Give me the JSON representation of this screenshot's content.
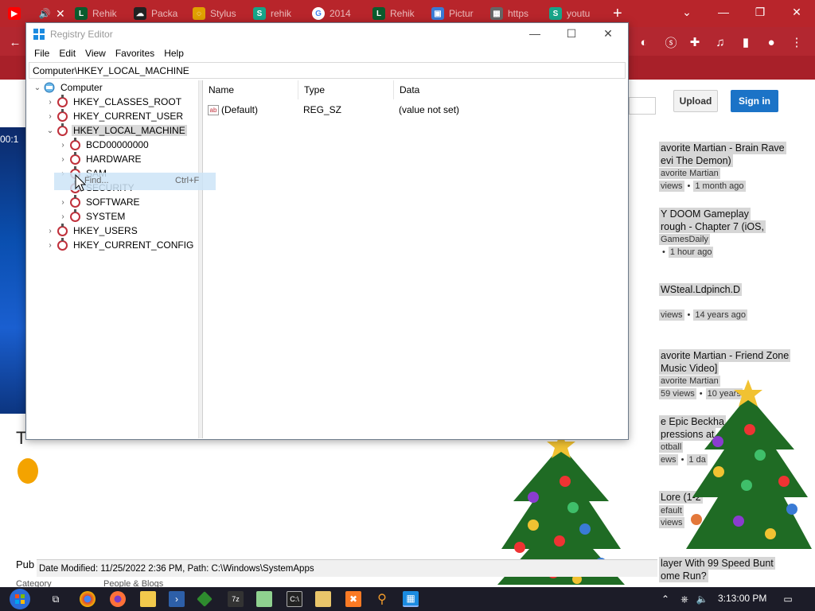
{
  "browser": {
    "tabs": [
      {
        "title": "",
        "color": "#ff0000",
        "glyph": "▶"
      },
      {
        "title": "",
        "color": "#b8252b",
        "glyph": "🔊"
      },
      {
        "title": "Rehik",
        "color": "#0b5c2e",
        "glyph": "L"
      },
      {
        "title": "Packa",
        "color": "#222222",
        "glyph": "☁"
      },
      {
        "title": "Stylus",
        "color": "#e0a000",
        "glyph": "◌"
      },
      {
        "title": "rehik",
        "color": "#17a589",
        "glyph": "S"
      },
      {
        "title": "2014",
        "color": "#ffffff",
        "glyph": "G"
      },
      {
        "title": "Rehik",
        "color": "#0b5c2e",
        "glyph": "L"
      },
      {
        "title": "Pictur",
        "color": "#3a7bd5",
        "glyph": "▣"
      },
      {
        "title": "https",
        "color": "#666666",
        "glyph": "▦"
      },
      {
        "title": "youtu",
        "color": "#17a589",
        "glyph": "S"
      }
    ],
    "new_tab": "+"
  },
  "webpage": {
    "upload_label": "Upload",
    "signin_label": "Sign in",
    "video_time": "00:1",
    "items": [
      {
        "title1": "avorite Martian - Brain Rave",
        "title2": "evi The Demon)",
        "channel": "avorite Martian",
        "views": "views",
        "ago": "1 month ago"
      },
      {
        "title1": "Y DOOM Gameplay",
        "title2": "rough - Chapter 7 (iOS,",
        "channel": "GamesDaily",
        "views": "",
        "ago": "1 hour ago"
      },
      {
        "title1": "WSteal.Ldpinch.D",
        "title2": "",
        "channel": "",
        "views": "views",
        "ago": "14 years ago"
      },
      {
        "title1": "avorite Martian - Friend Zone",
        "title2": "Music Video]",
        "channel": "avorite Martian",
        "views": "59 views",
        "ago": "10 years"
      },
      {
        "title1": "e Epic Beckha",
        "title2": "pressions at",
        "channel": "otball",
        "views": "ews",
        "ago": "1 da"
      },
      {
        "title1": "Lore (1-2",
        "title2": "",
        "channel": "efault",
        "views": "views",
        "ago": ""
      },
      {
        "title1": "layer With 99 Speed Bunt",
        "title2": "ome Run?",
        "channel": "",
        "views": "",
        "ago": ""
      }
    ],
    "bottom_left": "Pub",
    "category_label": "Category",
    "category_value": "People & Blogs",
    "left_letter": "T"
  },
  "regedit": {
    "title": "Registry Editor",
    "menu": [
      "File",
      "Edit",
      "View",
      "Favorites",
      "Help"
    ],
    "address": "Computer\\HKEY_LOCAL_MACHINE",
    "tree": {
      "root": "Computer",
      "hives": [
        "HKEY_CLASSES_ROOT",
        "HKEY_CURRENT_USER",
        "HKEY_LOCAL_MACHINE"
      ],
      "hklm_children": [
        "BCD00000000",
        "HARDWARE",
        "SAM",
        "SECURITY",
        "SOFTWARE",
        "SYSTEM"
      ],
      "after": [
        "HKEY_USERS",
        "HKEY_CURRENT_CONFIG"
      ]
    },
    "find_menu": {
      "label": "Find...",
      "shortcut": "Ctrl+F"
    },
    "columns": {
      "name": "Name",
      "type": "Type",
      "data": "Data"
    },
    "values": [
      {
        "name": "(Default)",
        "type": "REG_SZ",
        "data": "(value not set)",
        "icon": "ab"
      }
    ],
    "status": "Date Modified: 11/25/2022 2:36 PM, Path: C:\\Windows\\SystemApps"
  },
  "taskbar": {
    "clock": "3:13:00 PM",
    "apps": [
      "task-view",
      "chrome",
      "firefox",
      "file-explorer",
      "powershell",
      "git",
      "7zip",
      "notepadpp",
      "cmd",
      "keyboard",
      "xampp",
      "search-tool",
      "regedit"
    ]
  }
}
